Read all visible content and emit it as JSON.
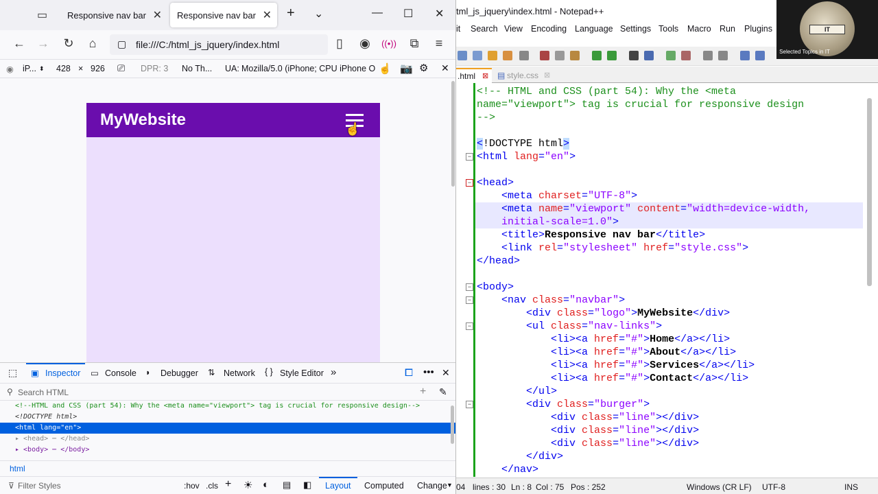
{
  "browser": {
    "tabs": [
      {
        "label": "Responsive nav bar"
      },
      {
        "label": "Responsive nav bar"
      }
    ],
    "url": "file:///C:/html_js_jquery/index.html",
    "rdm": {
      "device": "iP...",
      "width": "428",
      "times": "×",
      "height": "926",
      "dpr": "DPR: 3",
      "throttle": "No Th...",
      "ua_label": "UA:",
      "ua_value": "Mozilla/5.0 (iPhone; CPU iPhone O"
    },
    "page": {
      "logo": "MyWebsite",
      "nav_color": "#6a0dad",
      "bg_color": "#ecdffd"
    }
  },
  "devtools": {
    "tabs": [
      "Inspector",
      "Console",
      "Debugger",
      "Network",
      "Style Editor"
    ],
    "search_placeholder": "Search HTML",
    "tree": [
      "<!--HTML and CSS (part 54): Why the <meta name=\"viewport\"> tag is crucial for responsive design-->",
      "<!DOCTYPE html>",
      "<html lang=\"en\">",
      "▸ <head> ⋯ </head>",
      "▸ <body> ⋯ </body>"
    ],
    "breadcrumb": "html",
    "filter_placeholder": "Filter Styles",
    "hov": ":hov",
    "cls": ".cls",
    "layout_tab": "Layout",
    "computed_tab": "Computed",
    "changes_tab": "Change"
  },
  "notepad": {
    "title": "tml_js_jquery\\index.html - Notepad++",
    "menu": [
      "it",
      "Search",
      "View",
      "Encoding",
      "Language",
      "Settings",
      "Tools",
      "Macro",
      "Run",
      "Plugins"
    ],
    "tabs": [
      {
        "label": ".html"
      },
      {
        "label": "style.css"
      }
    ],
    "status": {
      "len": "04",
      "lines": "lines : 30",
      "ln": "Ln : 8",
      "col": "Col : 75",
      "pos": "Pos : 252",
      "eol": "Windows (CR LF)",
      "enc": "UTF-8",
      "ins": "INS"
    }
  },
  "webcam": {
    "caption": "Selected Topics in IT",
    "badge": "IT"
  }
}
